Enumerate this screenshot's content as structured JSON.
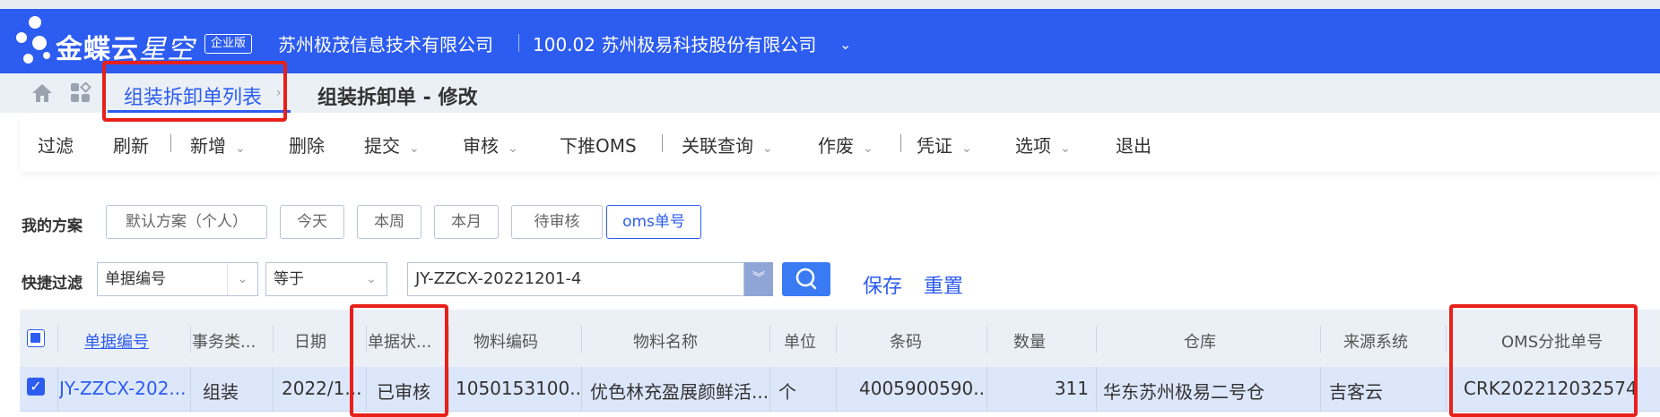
{
  "header": {
    "logo_bold": "金蝶云",
    "logo_thin": "星空",
    "edition": "企业版",
    "company": "苏州极茂信息技术有限公司",
    "org": "100.02 苏州极易科技股份有限公司",
    "brand_color": "#2c5cf0"
  },
  "tabs": [
    {
      "label": "组装拆卸单列表",
      "active": true
    },
    {
      "label": "组装拆卸单 - 修改",
      "active": false
    }
  ],
  "toolbar": {
    "filter": "过滤",
    "refresh": "刷新",
    "add": "新增",
    "delete": "删除",
    "submit": "提交",
    "audit": "审核",
    "push_oms": "下推OMS",
    "related_query": "关联查询",
    "void": "作废",
    "voucher": "凭证",
    "options": "选项",
    "exit": "退出"
  },
  "schemes": {
    "label": "我的方案",
    "items": [
      "默认方案（个人）",
      "今天",
      "本周",
      "本月",
      "待审核",
      "oms单号"
    ],
    "active_index": 5
  },
  "quick_filter": {
    "label": "快捷过滤",
    "field": "单据编号",
    "operator": "等于",
    "value": "JY-ZZCX-20221201-4",
    "save": "保存",
    "reset": "重置"
  },
  "grid": {
    "headers": {
      "bill_no": "单据编号",
      "biz_type": "事务类...",
      "date": "日期",
      "status": "单据状...",
      "material_code": "物料编码",
      "material_name": "物料名称",
      "unit": "单位",
      "barcode": "条码",
      "qty": "数量",
      "warehouse": "仓库",
      "source": "来源系统",
      "oms_no": "OMS分批单号"
    },
    "rows": [
      {
        "checked": true,
        "bill_no": "JY-ZZCX-202...",
        "biz_type": "组装",
        "date": "2022/1...",
        "status": "已审核",
        "material_code": "1050153100...",
        "material_name": "优色林充盈展颜鲜活...",
        "unit": "个",
        "barcode": "4005900590...",
        "qty": "311",
        "warehouse": "华东苏州极易二号仓",
        "source": "吉客云",
        "oms_no": "CRK202212032574"
      }
    ]
  }
}
